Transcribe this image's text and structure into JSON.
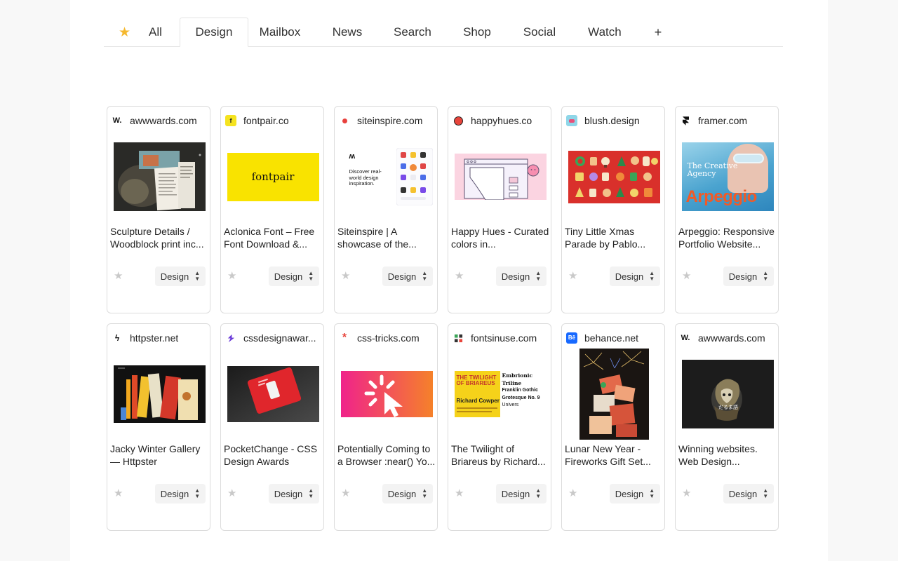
{
  "tabs": [
    {
      "key": "star",
      "label": "★",
      "active": false
    },
    {
      "key": "all",
      "label": "All",
      "active": false
    },
    {
      "key": "design",
      "label": "Design",
      "active": true
    },
    {
      "key": "mailbox",
      "label": "Mailbox",
      "active": false
    },
    {
      "key": "news",
      "label": "News",
      "active": false
    },
    {
      "key": "search",
      "label": "Search",
      "active": false
    },
    {
      "key": "shop",
      "label": "Shop",
      "active": false
    },
    {
      "key": "social",
      "label": "Social",
      "active": false
    },
    {
      "key": "watch",
      "label": "Watch",
      "active": false
    },
    {
      "key": "plus",
      "label": "+",
      "active": false
    }
  ],
  "colors": {
    "accent_star": "#f5b82e",
    "card_border": "#dcdcdc",
    "inactive_star": "#c9c9c9"
  },
  "cards": [
    {
      "domain": "awwwards.com",
      "icon": "awwwards-icon",
      "icon_text": "W.",
      "title": "Sculpture Details / Woodblock print inc...",
      "tag": "Design"
    },
    {
      "domain": "fontpair.co",
      "icon": "fontpair-icon",
      "icon_text": "",
      "title": "Aclonica Font – Free Font Download &...",
      "tag": "Design",
      "thumb_text": "fontpair"
    },
    {
      "domain": "siteinspire.com",
      "icon": "siteinspire-icon",
      "icon_text": "",
      "title": "Siteinspire | A showcase of the...",
      "tag": "Design",
      "thumb_text": "Discover real-world design inspiration."
    },
    {
      "domain": "happyhues.co",
      "icon": "happyhues-icon",
      "icon_text": "",
      "title": "Happy Hues - Curated colors in...",
      "tag": "Design"
    },
    {
      "domain": "blush.design",
      "icon": "blush-icon",
      "icon_text": "",
      "title": "Tiny Little Xmas Parade by Pablo...",
      "tag": "Design"
    },
    {
      "domain": "framer.com",
      "icon": "framer-icon",
      "icon_text": "",
      "title": "Arpeggio: Responsive Portfolio Website...",
      "tag": "Design",
      "thumb_text": "The Creative Agency",
      "thumb_text_2": "Arpeggio"
    },
    {
      "domain": "httpster.net",
      "icon": "httpster-icon",
      "icon_text": "ϟ",
      "title": "Jacky Winter Gallery — Httpster",
      "tag": "Design"
    },
    {
      "domain": "cssdesignawar...",
      "icon": "cssdesignawards-icon",
      "icon_text": "",
      "title": "PocketChange - CSS Design Awards",
      "tag": "Design"
    },
    {
      "domain": "css-tricks.com",
      "icon": "css-tricks-icon",
      "icon_text": "*",
      "title": "Potentially Coming to a Browser :near() Yo...",
      "tag": "Design"
    },
    {
      "domain": "fontsinuse.com",
      "icon": "fontsinuse-icon",
      "icon_text": "",
      "title": "The Twilight of Briareus by Richard...",
      "tag": "Design",
      "thumb_text": "THE TWILIGHT OF BRIAREUS",
      "thumb_text_2": "Richard Cowper",
      "thumb_text_3": "Embrionic Triline",
      "thumb_text_4": "Franklin Gothic",
      "thumb_text_5": "Grotesque No. 9",
      "thumb_text_6": "Univers"
    },
    {
      "domain": "behance.net",
      "icon": "behance-icon",
      "icon_text": "Bē",
      "title": "Lunar New Year - Fireworks Gift Set...",
      "tag": "Design"
    },
    {
      "domain": "awwwards.com",
      "icon": "awwwards-icon",
      "icon_text": "W.",
      "title": "Winning websites. Web Design...",
      "tag": "Design"
    }
  ]
}
